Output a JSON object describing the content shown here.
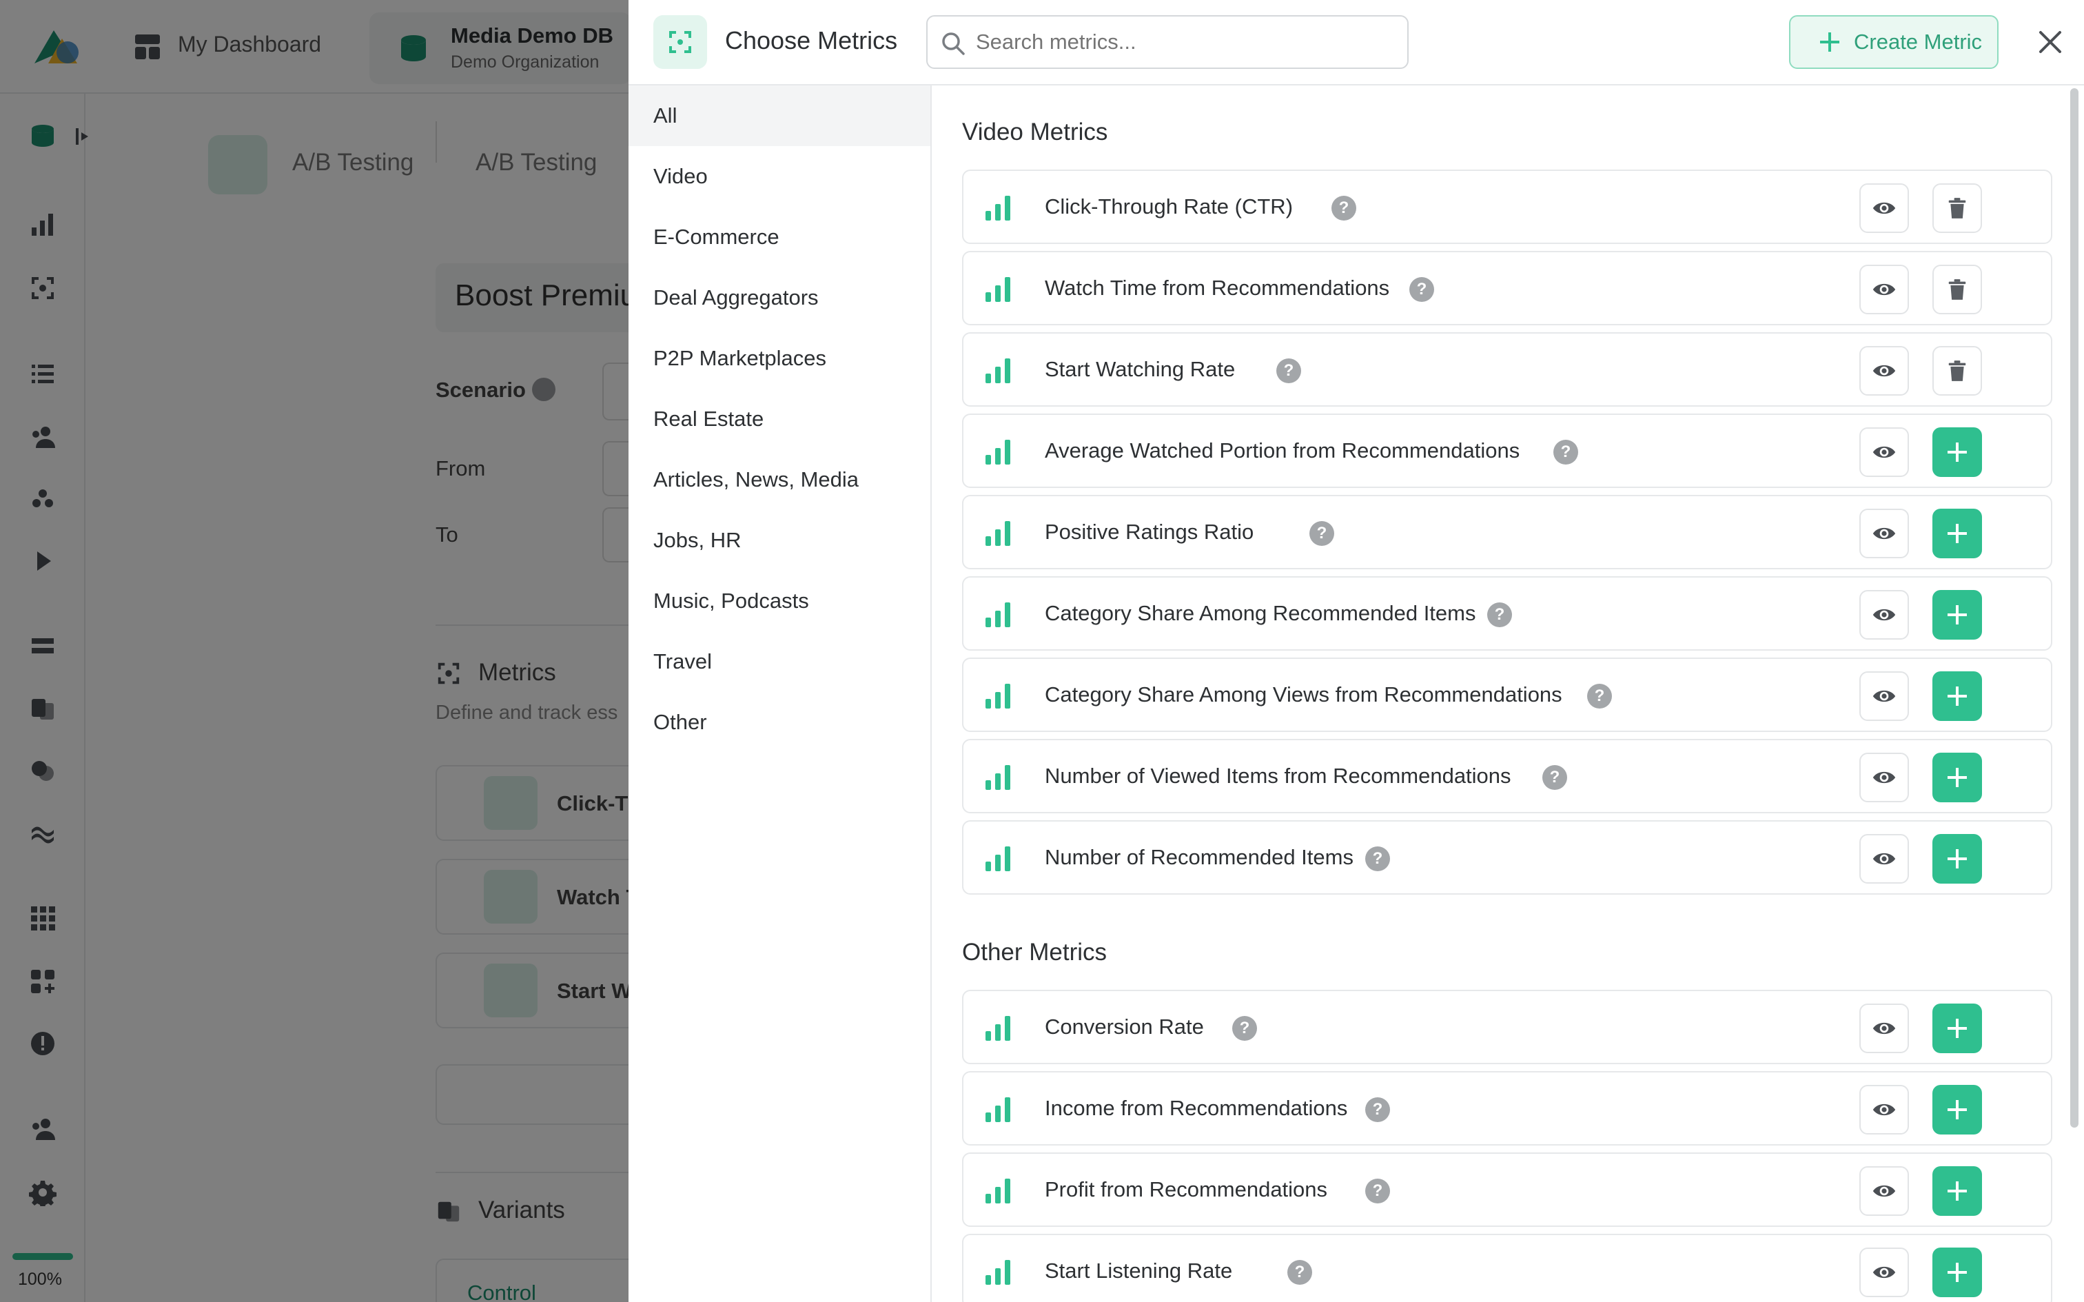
{
  "background": {
    "topbar": {
      "dashboard_label": "My Dashboard",
      "db_name": "Media Demo DB",
      "org_name": "Demo Organization"
    },
    "tabs": [
      "A/B Testing",
      "A/B Testing"
    ],
    "page_title": "Boost Premiu",
    "form": {
      "scenario_label": "Scenario",
      "from_label": "From",
      "to_label": "To"
    },
    "metrics_section": {
      "title": "Metrics",
      "subtitle": "Define and track ess",
      "items": [
        "Click-Th",
        "Watch T",
        "Start W"
      ]
    },
    "variants_title": "Variants",
    "control_label": "Control",
    "zoom_label": "100%"
  },
  "modal": {
    "title": "Choose Metrics",
    "search_placeholder": "Search metrics...",
    "create_button": "Create Metric",
    "categories": [
      {
        "label": "All",
        "active": true
      },
      {
        "label": "Video",
        "active": false
      },
      {
        "label": "E-Commerce",
        "active": false
      },
      {
        "label": "Deal Aggregators",
        "active": false
      },
      {
        "label": "P2P Marketplaces",
        "active": false
      },
      {
        "label": "Real Estate",
        "active": false
      },
      {
        "label": "Articles, News, Media",
        "active": false
      },
      {
        "label": "Jobs, HR",
        "active": false
      },
      {
        "label": "Music, Podcasts",
        "active": false
      },
      {
        "label": "Travel",
        "active": false
      },
      {
        "label": "Other",
        "active": false
      }
    ],
    "sections": [
      {
        "title": "Video Metrics",
        "metrics": [
          {
            "name": "Click-Through Rate (CTR)",
            "action": "delete"
          },
          {
            "name": "Watch Time from Recommendations",
            "action": "delete"
          },
          {
            "name": "Start Watching Rate",
            "action": "delete"
          },
          {
            "name": "Average Watched Portion from Recommendations",
            "action": "add"
          },
          {
            "name": "Positive Ratings Ratio",
            "action": "add"
          },
          {
            "name": "Category Share Among Recommended Items",
            "action": "add"
          },
          {
            "name": "Category Share Among Views from Recommendations",
            "action": "add"
          },
          {
            "name": "Number of Viewed Items from Recommendations",
            "action": "add"
          },
          {
            "name": "Number of Recommended Items",
            "action": "add"
          }
        ]
      },
      {
        "title": "Other Metrics",
        "metrics": [
          {
            "name": "Conversion Rate",
            "action": "add"
          },
          {
            "name": "Income from Recommendations",
            "action": "add"
          },
          {
            "name": "Profit from Recommendations",
            "action": "add"
          },
          {
            "name": "Start Listening Rate",
            "action": "add"
          }
        ]
      }
    ],
    "help_glyph": "?",
    "colors": {
      "accent": "#2fbf8f",
      "accent_light": "#e3f5ee",
      "border": "#e6e8ea",
      "text": "#2d3033",
      "help": "#a3a6a9"
    }
  }
}
